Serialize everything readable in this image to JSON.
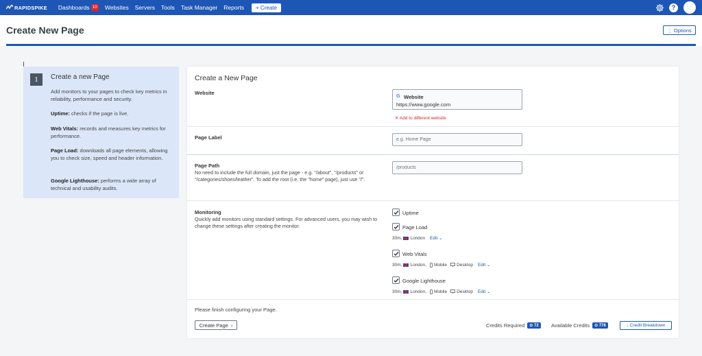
{
  "app": {
    "logo_text": "RAPIDSPIKE"
  },
  "nav": {
    "items": [
      {
        "label": "Dashboards",
        "badge": "10"
      },
      {
        "label": "Websites"
      },
      {
        "label": "Servers"
      },
      {
        "label": "Tools"
      },
      {
        "label": "Task Manager"
      },
      {
        "label": "Reports"
      }
    ],
    "create_label": "+ Create"
  },
  "header": {
    "title": "Create New Page",
    "options_label": "⋮ Options"
  },
  "sidebar": {
    "step": "1",
    "title": "Create a new Page",
    "intro": "Add monitors to your pages to check key metrics in reliability, performance and security.",
    "features": [
      {
        "name": "Uptime:",
        "text": " checks if the page is live."
      },
      {
        "name": "Web Vitals:",
        "text": " records and measures key metrics for performance."
      },
      {
        "name": "Page Load:",
        "text": " downloads all page elements, allowing you to check size, speed and header information."
      },
      {
        "name": "Google Lighthouse:",
        "text": " performs a wide array of technical and usability audits."
      }
    ]
  },
  "form": {
    "title": "Create a New Page",
    "website": {
      "label": "Website",
      "icon_letter": "G",
      "name": "Website",
      "url": "https://www.google.com",
      "add_different": "Add to different website"
    },
    "page_label": {
      "label": "Page Label",
      "placeholder": "e.g. Home Page"
    },
    "page_path": {
      "label": "Page Path",
      "description": "No need to include the full domain, just the page - e.g. \"/about\", \"/products\" or \"/categories/shoes/leather\". To add the root (i.e. the \"home\" page), just use \"/\".",
      "placeholder": "/products"
    },
    "monitoring": {
      "label": "Monitoring",
      "description": "Quickly add monitors using standard settings. For advanced users, you may wish to change these settings after creating the monitor.",
      "uptime": {
        "label": "Uptime",
        "checked": true
      },
      "page_load": {
        "label": "Page Load",
        "checked": true,
        "interval": "30m,",
        "location": "London",
        "edit": "Edit"
      },
      "web_vitals": {
        "label": "Web Vitals",
        "checked": true,
        "interval": "30m,",
        "location": "London,",
        "device1": "Mobile",
        "device2": "Desktop",
        "edit": "Edit"
      },
      "lighthouse": {
        "label": "Google Lighthouse",
        "checked": true,
        "interval": "30m,",
        "location": "London,",
        "device1": "Mobile",
        "device2": "Desktop",
        "edit": "Edit"
      }
    },
    "footer": {
      "message": "Please finish configuring your Page.",
      "create_label": "Create Page",
      "credits_required_label": "Credits Required",
      "credits_required_value": "72",
      "available_credits_label": "Available Credits",
      "available_credits_value": "776",
      "breakdown_label": "Credit Breakdown"
    }
  },
  "colors": {
    "brand": "#1d56b5",
    "danger": "#d9262f",
    "side_bg": "#dbe7f8"
  }
}
